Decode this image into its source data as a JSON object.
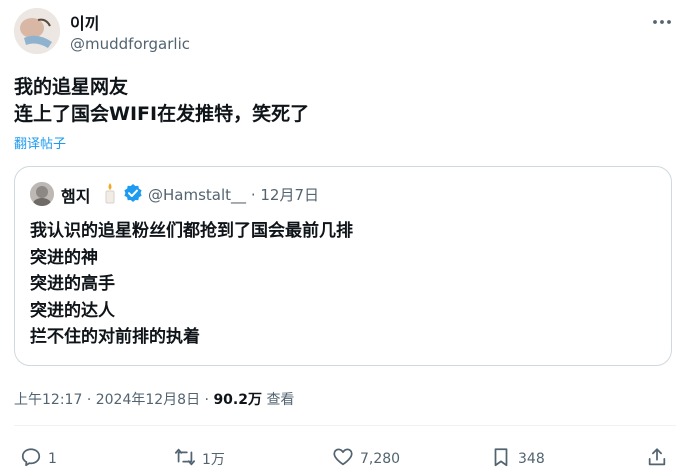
{
  "author": {
    "name": "이끼",
    "handle": "@muddforgarlic"
  },
  "tweet": {
    "lines": [
      "我的追星网友",
      "连上了国会WIFI在发推特，笑死了"
    ],
    "translate_label": "翻译帖子"
  },
  "quote": {
    "name": "햄지",
    "handle": "@Hamstalt__",
    "sep": "·",
    "date": "12月7日",
    "lines": [
      "我认识的追星粉丝们都抢到了国会最前几排",
      "突进的神",
      "突进的高手",
      "突进的达人",
      "拦不住的对前排的执着"
    ]
  },
  "meta": {
    "time": "上午12:17",
    "sep": "·",
    "date": "2024年12月8日",
    "sep2": "·",
    "views": "90.2万",
    "views_label": "查看"
  },
  "actions": {
    "replies": "1",
    "retweets": "1万",
    "likes": "7,280",
    "bookmarks": "348"
  },
  "colors": {
    "link": "#1d9bf0",
    "muted": "#536471",
    "border": "#cfd9de"
  }
}
